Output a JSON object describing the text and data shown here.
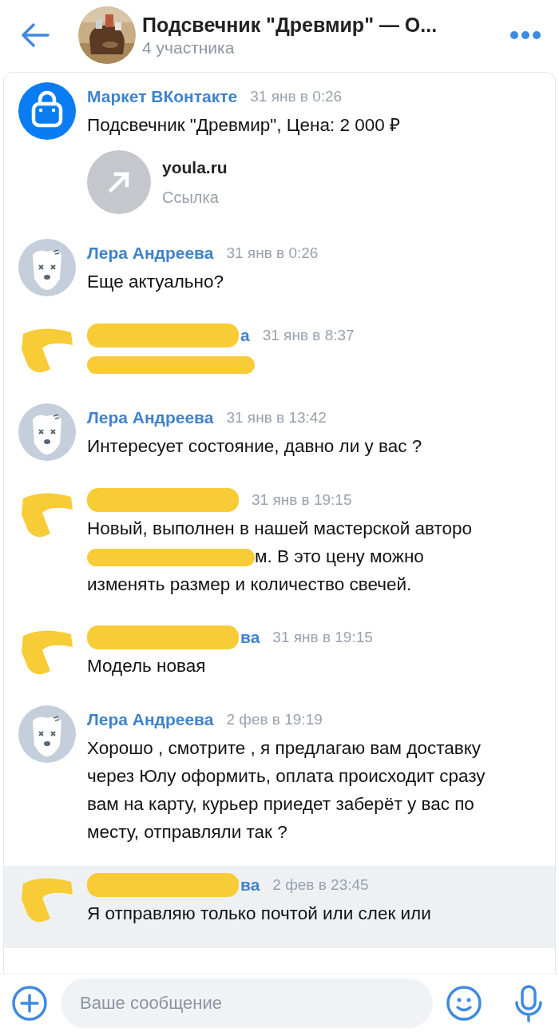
{
  "header": {
    "title": "Подсвечник \"Древмир\" — О...",
    "subtitle": "4 участника"
  },
  "messages": [
    {
      "kind": "market",
      "sender": [
        {
          "kind": "text",
          "text": "Маркет ВКонтакте"
        }
      ],
      "time": "31 янв в 0:26",
      "body": [
        {
          "kind": "text",
          "text": "Подсвечник \"Древмир\", Цена: 2 000 ₽"
        }
      ],
      "link": {
        "title": "youla.ru",
        "caption": "Ссылка"
      },
      "unread": false
    },
    {
      "kind": "deleted",
      "sender": [
        {
          "kind": "text",
          "text": "Лера Андреева"
        }
      ],
      "time": "31 янв в 0:26",
      "body": [
        {
          "kind": "text",
          "text": "Еще актуально?"
        }
      ],
      "unread": false
    },
    {
      "kind": "redacted",
      "sender": [
        {
          "kind": "redacted"
        },
        {
          "kind": "text",
          "text": "а"
        }
      ],
      "time": "31 янв в 8:37",
      "body": [
        {
          "kind": "redacted"
        }
      ],
      "unread": false
    },
    {
      "kind": "deleted",
      "sender": [
        {
          "kind": "text",
          "text": "Лера Андреева"
        }
      ],
      "time": "31 янв в 13:42",
      "body": [
        {
          "kind": "text",
          "text": "Интересует состояние, давно ли у вас ?"
        }
      ],
      "unread": false
    },
    {
      "kind": "redacted",
      "sender": [
        {
          "kind": "redacted"
        }
      ],
      "time": "31 янв в 19:15",
      "body": [
        {
          "kind": "text",
          "text": "Новый, выполнен в нашей мастерской авторо"
        },
        {
          "kind": "redacted"
        },
        {
          "kind": "text",
          "text": "м. В это цену можно изменять размер и количество свечей."
        }
      ],
      "unread": false
    },
    {
      "kind": "redacted",
      "sender": [
        {
          "kind": "redacted"
        },
        {
          "kind": "text",
          "text": "ва"
        }
      ],
      "time": "31 янв в 19:15",
      "body": [
        {
          "kind": "text",
          "text": "Модель новая"
        }
      ],
      "unread": false
    },
    {
      "kind": "deleted",
      "sender": [
        {
          "kind": "text",
          "text": "Лера Андреева"
        }
      ],
      "time": "2 фев в 19:19",
      "body": [
        {
          "kind": "text",
          "text": "Хорошо , смотрите , я предлагаю вам доставку через Юлу оформить, оплата происходит сразу вам на карту, курьер приедет заберёт у вас по месту, отправляли так ?"
        }
      ],
      "unread": false
    },
    {
      "kind": "redacted",
      "sender": [
        {
          "kind": "redacted"
        },
        {
          "kind": "text",
          "text": "ва"
        }
      ],
      "time": "2 фев в 23:45",
      "body": [
        {
          "kind": "text",
          "text": "Я отправляю только почтой или слек или"
        }
      ],
      "unread": true
    }
  ],
  "composer": {
    "placeholder": "Ваше сообщение"
  }
}
